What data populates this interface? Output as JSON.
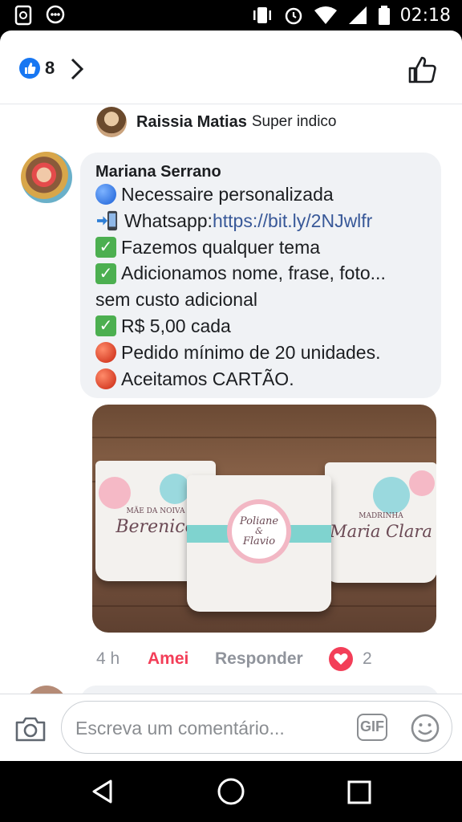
{
  "status_bar": {
    "time": "02:18",
    "icons": [
      "screenshot-icon",
      "messenger-icon",
      "vibrate-icon",
      "alarm-icon",
      "wifi-icon",
      "signal-icon",
      "battery-icon"
    ]
  },
  "header": {
    "like_count": "8"
  },
  "reply_preview": {
    "name": "Raissia Matias",
    "text": "Super indico"
  },
  "comment": {
    "author": "Mariana Serrano",
    "lines": [
      "Necessaire personalizada",
      " Whatsapp: ",
      "Fazemos qualquer tema",
      "Adicionamos nome, frase, foto...",
      "sem custo adicional",
      "R$ 5,00 cada",
      "Pedido mínimo de 20 unidades.",
      "Aceitamos CARTÃO."
    ],
    "link": "https://bit.ly/2NJwlfr",
    "photo_texts": {
      "left_top": "MÃE DA NOIVA",
      "left_name": "Berenice",
      "center_name1": "Poliane",
      "center_amp": "&",
      "center_name2": "Flavio",
      "right_top": "MADRINHA",
      "right_name": "Maria Clara"
    },
    "time": "4 h",
    "reaction_label": "Amei",
    "reply_label": "Responder",
    "reaction_count": "2"
  },
  "composer": {
    "placeholder": "Escreva um comentário...",
    "gif_label": "GIF"
  },
  "colors": {
    "facebook_blue": "#1877f2",
    "love_red": "#f33e58",
    "bubble_gray": "#f0f2f5",
    "link": "#385898"
  }
}
